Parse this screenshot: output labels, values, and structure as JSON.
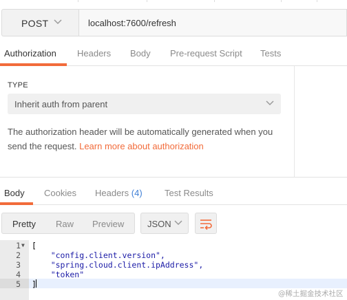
{
  "request": {
    "method": "POST",
    "url": "localhost:7600/refresh"
  },
  "request_tabs": [
    "Authorization",
    "Headers",
    "Body",
    "Pre-request Script",
    "Tests"
  ],
  "auth": {
    "type_label": "TYPE",
    "type_value": "Inherit auth from parent",
    "description": "The authorization header will be automatically generated when you send the request.",
    "learn_more": "Learn more about authorization"
  },
  "response_tabs": {
    "body": "Body",
    "cookies": "Cookies",
    "headers": "Headers",
    "headers_count": "(4)",
    "test_results": "Test Results"
  },
  "view_modes": [
    "Pretty",
    "Raw",
    "Preview"
  ],
  "format": "JSON",
  "code_lines": [
    {
      "n": "1",
      "text": "["
    },
    {
      "n": "2",
      "text": "    \"config.client.version\","
    },
    {
      "n": "3",
      "text": "    \"spring.cloud.client.ipAddress\","
    },
    {
      "n": "4",
      "text": "    \"token\""
    },
    {
      "n": "5",
      "text": "]"
    }
  ],
  "watermark": "@稀土掘金技术社区",
  "colors": {
    "accent": "#f26b3a",
    "link_blue": "#3f7fd6",
    "string_blue": "#1a1aa6"
  },
  "icons": [
    "chevron-down-icon",
    "wrap-lines-icon",
    "fold-arrow-icon"
  ]
}
